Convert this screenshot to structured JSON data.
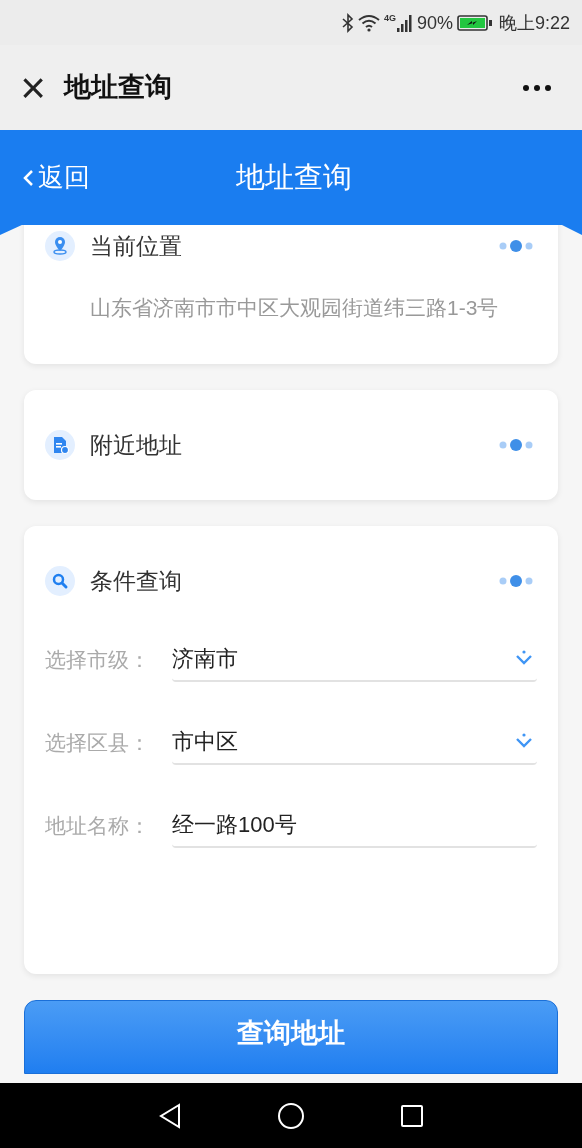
{
  "status_bar": {
    "network": "4G",
    "battery": "90%",
    "time": "晚上9:22"
  },
  "title_bar": {
    "title": "地址查询",
    "close": "×"
  },
  "header": {
    "back": "返回",
    "title": "地址查询"
  },
  "cards": [
    {
      "kind": "location",
      "title": "当前位置",
      "text": "山东省济南市市中区大观园街道纬三路1-3号"
    },
    {
      "kind": "nearby",
      "title": "附近地址"
    },
    {
      "kind": "search",
      "title": "条件查询",
      "fields": [
        {
          "kind": "select",
          "label": "选择市级：",
          "value": "济南市"
        },
        {
          "kind": "select",
          "label": "选择区县：",
          "value": "市中区"
        },
        {
          "kind": "text",
          "label": "地址名称：",
          "value": "经一路100号"
        }
      ]
    }
  ],
  "submit": "查询地址"
}
